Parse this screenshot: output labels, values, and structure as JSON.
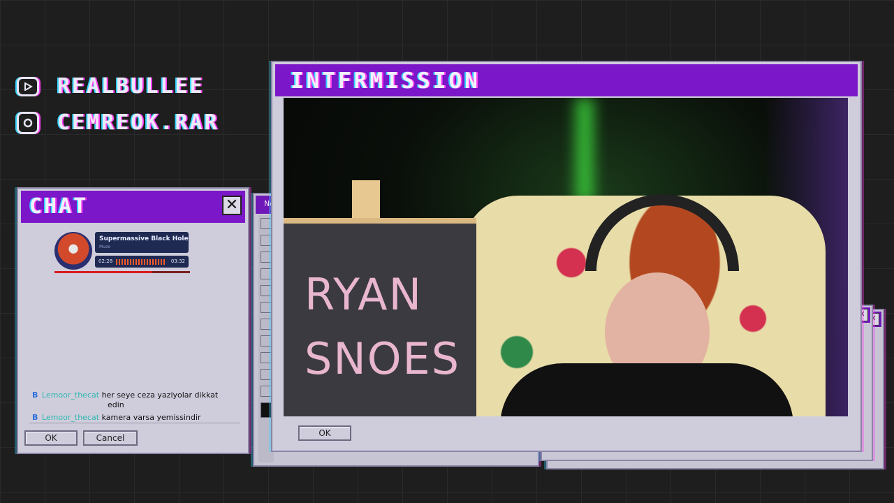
{
  "socials": [
    {
      "icon": "youtube-icon",
      "handle": "REALBULLEE"
    },
    {
      "icon": "instagram-icon",
      "handle": "CEMREOK.RAR"
    }
  ],
  "chat_window": {
    "title": "CHAT",
    "close_label": "✕",
    "now_playing": {
      "track": "Supermassive Black Hole",
      "artist": "Muse",
      "elapsed": "02:28",
      "duration": "03:32",
      "progress": 0.72
    },
    "messages": [
      {
        "badge": "B",
        "user": "Lemoor_thecat",
        "text": "her seye ceza yaziyolar dikkat",
        "text_cont": "edin"
      },
      {
        "badge": "B",
        "user": "Lemoor_thecat",
        "text": "kamera varsa yemissindir"
      }
    ],
    "ok_label": "OK",
    "cancel_label": "Cancel"
  },
  "back_window": {
    "title": "Ne"
  },
  "main_window": {
    "title": "INTFRMISSION",
    "board_text_line1": "RYAN",
    "board_text_line2": "SNOES",
    "ok_label": "OK"
  },
  "colors": {
    "title_bar": "#7b17c8",
    "window_bg": "#cfcddc",
    "page_bg": "#1e1e1e"
  }
}
